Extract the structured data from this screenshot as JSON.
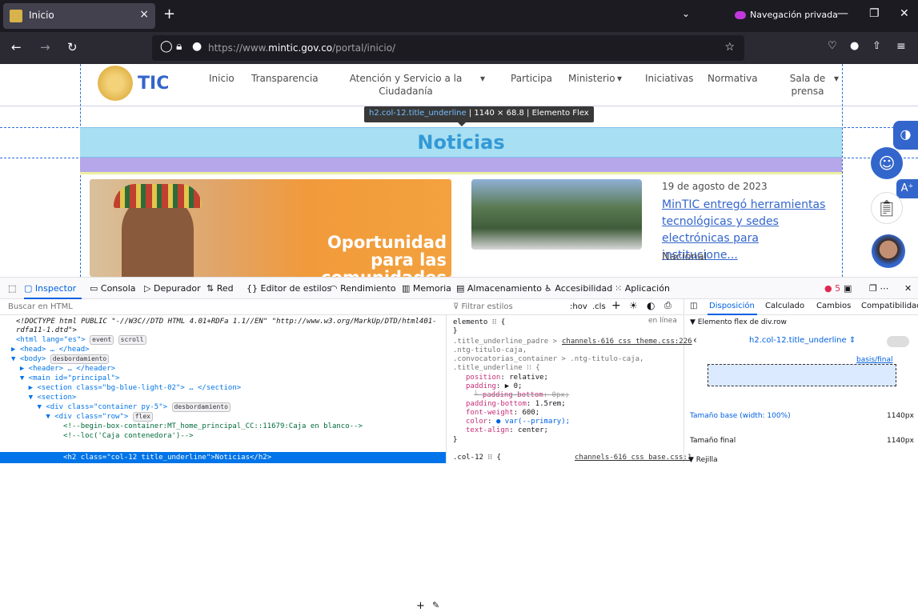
{
  "browser": {
    "tab_title": "Inicio",
    "private_label": "Navegación privada",
    "url_prefix": "https://www.",
    "url_domain": "mintic.gov.co",
    "url_path": "/portal/inicio/"
  },
  "site": {
    "logo_text": "TIC",
    "menu": [
      "Inicio",
      "Transparencia",
      "Atención y Servicio a la Ciudadanía",
      "Participa",
      "Ministerio",
      "Iniciativas",
      "Normativa",
      "Sala de prensa"
    ],
    "tooltip_selector": "h2.col-12.title_underline",
    "tooltip_size": "1140 × 68.8",
    "tooltip_type": "Elemento Flex",
    "heading": "Noticias",
    "promo_text": "Oportunidad para las comunidades",
    "news_date": "19 de agosto de 2023",
    "news_title": "MinTIC entregó herramientas tecnológicas y sedes electrónicas para institucione...",
    "news_category": "Nacional",
    "accent_color": "#3366cc"
  },
  "devtools": {
    "tabs": [
      "Inspector",
      "Consola",
      "Depurador",
      "Red",
      "Editor de estilos",
      "Rendimiento",
      "Memoria",
      "Almacenamiento",
      "Accesibilidad",
      "Aplicación"
    ],
    "error_count": "5",
    "search_placeholder": "Buscar en HTML",
    "html_lines": [
      "<!DOCTYPE html PUBLIC \"-//W3C//DTD HTML 4.01+RDFa 1.1//EN\" \"http://www.w3.org/MarkUp/DTD/html401-",
      "rdfa11-1.dtd\">",
      "<html lang=\"es\">",
      "▶ <head> … </head>",
      "▼ <body>",
      "  ▶ <header> … </header>",
      "  ▼ <main id=\"principal\">",
      "    ▶ <section class=\"bg-blue-light-02\"> … </section>",
      "    ▼ <section>",
      "      ▼ <div class=\"container py-5\">",
      "        ▼ <div class=\"row\">",
      "            <!--begin-box-container:MT_home_principal_CC::11679:Caja en blanco-->",
      "            <!--loc('Caja contenedora')-->",
      "            <h2 class=\"col-12 title_underline\">Noticias</h2>"
    ],
    "badges": {
      "event": "event",
      "scroll": "scroll",
      "overflow": "desbordamiento",
      "flex": "flex"
    },
    "styles_filter": "Filtrar estilos",
    "styles_pseudo": ":hov",
    "styles_cls": ".cls",
    "element_rule": "elemento ⁝⁝ {",
    "inline_label": "en línea",
    "rule_selector": ".title_underline_padre >\n.ntg-titulo-caja,\n.convocatorias_container > .ntg-titulo-caja,\n.title_underline ⁝⁝ {",
    "rule_source": "channels-616 css theme.css:226",
    "declarations": [
      {
        "prop": "position",
        "val": "relative;"
      },
      {
        "prop": "padding",
        "val": "▶ 0;"
      },
      {
        "prop": "padding-bottom",
        "val": "0px;",
        "struck": true
      },
      {
        "prop": "padding-bottom",
        "val": "1.5rem;"
      },
      {
        "prop": "font-weight",
        "val": "600;"
      },
      {
        "prop": "color",
        "val": "● var(--primary);"
      },
      {
        "prop": "text-align",
        "val": "center;"
      }
    ],
    "rule2_selector": ".col-12 ⁝⁝ {",
    "rule2_source": "channels-616 css base.css:1",
    "layout_tabs": [
      "Disposición",
      "Calculado",
      "Cambios",
      "Compatibilidad"
    ],
    "flex_header": "Elemento flex de div.row",
    "flex_item": "h2.col-12.title_underline",
    "basis_label": "basis/final",
    "base_size_label": "Tamaño base",
    "base_size_note": "(width: 100%)",
    "base_size_val": "1140px",
    "final_size_label": "Tamaño final",
    "final_size_val": "1140px",
    "grid_label": "Rejilla"
  }
}
